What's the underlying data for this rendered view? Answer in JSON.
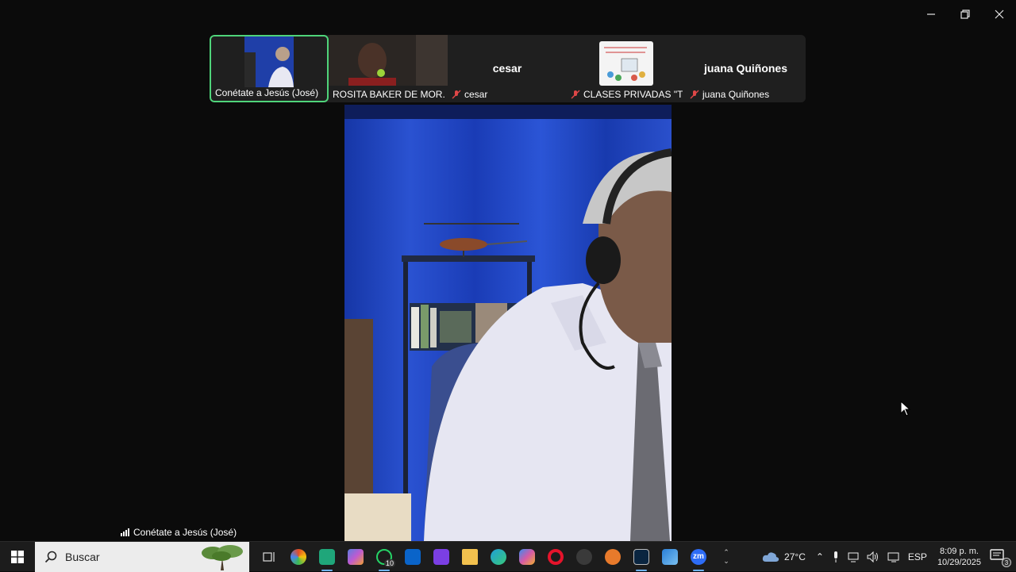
{
  "window": {
    "controls": [
      "minimize",
      "restore",
      "close"
    ]
  },
  "participants": [
    {
      "name": "Conétate a Jesús (José)",
      "active": true,
      "muted": false,
      "thumbnail": "video"
    },
    {
      "name": "ROSITA BAKER DE MOR...",
      "active": false,
      "muted": false,
      "thumbnail": "video"
    },
    {
      "name": "cesar",
      "big_name": "cesar",
      "active": false,
      "muted": true,
      "thumbnail": "none"
    },
    {
      "name": "CLASES PRIVADAS \"T...",
      "active": false,
      "muted": true,
      "thumbnail": "image"
    },
    {
      "name": "juana Quiñones",
      "big_name": "juana Quiñones",
      "active": false,
      "muted": true,
      "thumbnail": "none"
    }
  ],
  "speaker_label": "Conétate a Jesús (José)",
  "taskbar": {
    "search_placeholder": "Buscar",
    "apps": [
      {
        "name": "task-view-icon",
        "color": "#1c1c1c"
      },
      {
        "name": "color-wheel-app-icon",
        "color": "#e34c26"
      },
      {
        "name": "app-green-icon",
        "color": "#1fa67a"
      },
      {
        "name": "microsoft-365-icon",
        "color": "#6a5acd"
      },
      {
        "name": "whatsapp-icon",
        "color": "#25d366",
        "badge": "10"
      },
      {
        "name": "outlook-icon",
        "color": "#0a64c9"
      },
      {
        "name": "clapper-app-icon",
        "color": "#7b3fe4"
      },
      {
        "name": "file-explorer-icon",
        "color": "#f2c14e"
      },
      {
        "name": "edge-icon",
        "color": "#1fa0d9"
      },
      {
        "name": "copilot-icon",
        "color": "#d65aa6"
      },
      {
        "name": "opera-icon",
        "color": "#e5132b"
      },
      {
        "name": "app-dark-icon",
        "color": "#333333"
      },
      {
        "name": "app-orange-icon",
        "color": "#e87a2b"
      },
      {
        "name": "terminal-icon",
        "color": "#0a2540"
      },
      {
        "name": "photos-icon",
        "color": "#2a7fd6"
      },
      {
        "name": "zoom-icon",
        "color": "#2d6cf6",
        "text": "zm"
      }
    ],
    "weather": "27°C",
    "language": "ESP",
    "time": "8:09 p. m.",
    "date": "10/29/2025",
    "notification_count": "3"
  }
}
